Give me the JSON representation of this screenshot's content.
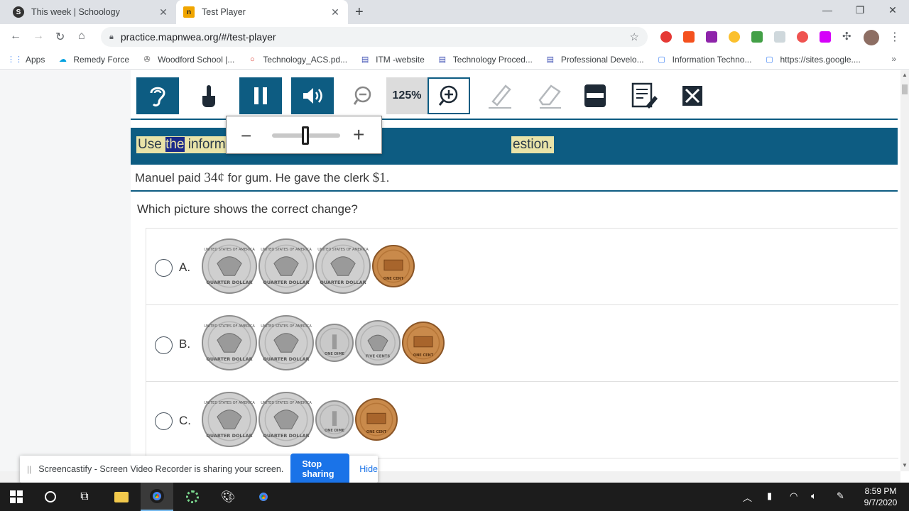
{
  "browser": {
    "tabs": [
      {
        "label": "This week | Schoology",
        "active": false
      },
      {
        "label": "Test Player",
        "active": true
      }
    ],
    "url": "practice.mapnwea.org/#/test-player",
    "bookmarks": [
      "Apps",
      "Remedy Force",
      "Woodford School |...",
      "Technology_ACS.pd...",
      "ITM -website",
      "Technology Proced...",
      "Professional Develo...",
      "Information Techno...",
      "https://sites.google...."
    ]
  },
  "test_toolbar": {
    "zoom_value": "125%",
    "tools": [
      "listen-icon",
      "touch-icon",
      "pause-icon",
      "volume-icon",
      "zoom-out-icon",
      "zoom-in-icon",
      "highlighter-icon",
      "eraser-icon",
      "line-reader-icon",
      "notepad-icon",
      "answer-eliminator-icon"
    ]
  },
  "zoom_popup": {
    "minus": "−",
    "plus": "+",
    "level": 0.5
  },
  "banner": {
    "before": "Use ",
    "highlight": "the",
    "after": " informa",
    "tail": "estion."
  },
  "passage": {
    "p1": "Manuel paid ",
    "amount1": "34¢",
    "p2": " for gum. He gave the clerk ",
    "amount2": "$1",
    "p3": "."
  },
  "question": "Which picture shows the correct change?",
  "options": [
    {
      "label": "A.",
      "coins": [
        "quarter",
        "quarter",
        "quarter",
        "penny"
      ]
    },
    {
      "label": "B.",
      "coins": [
        "quarter",
        "quarter",
        "dime",
        "nickel",
        "penny"
      ]
    },
    {
      "label": "C.",
      "coins": [
        "quarter",
        "quarter",
        "dime",
        "penny"
      ]
    }
  ],
  "coin_text": {
    "quarter_top": "UNITED STATES OF AMERICA",
    "quarter_bottom": "QUARTER DOLLAR",
    "dime_bottom": "ONE DIME",
    "nickel_bottom": "FIVE CENTS",
    "penny_bottom": "ONE CENT"
  },
  "screencastify": {
    "message": "Screencastify - Screen Video Recorder is sharing your screen.",
    "stop": "Stop sharing",
    "hide": "Hide"
  },
  "taskbar": {
    "time": "8:59 PM",
    "date": "9/7/2020"
  },
  "colors": {
    "accent": "#0d5c82",
    "highlight": "#e9e3a8",
    "quarter": "#c9c9c9",
    "penny": "#c98a4b",
    "stop_button": "#1a73e8"
  }
}
